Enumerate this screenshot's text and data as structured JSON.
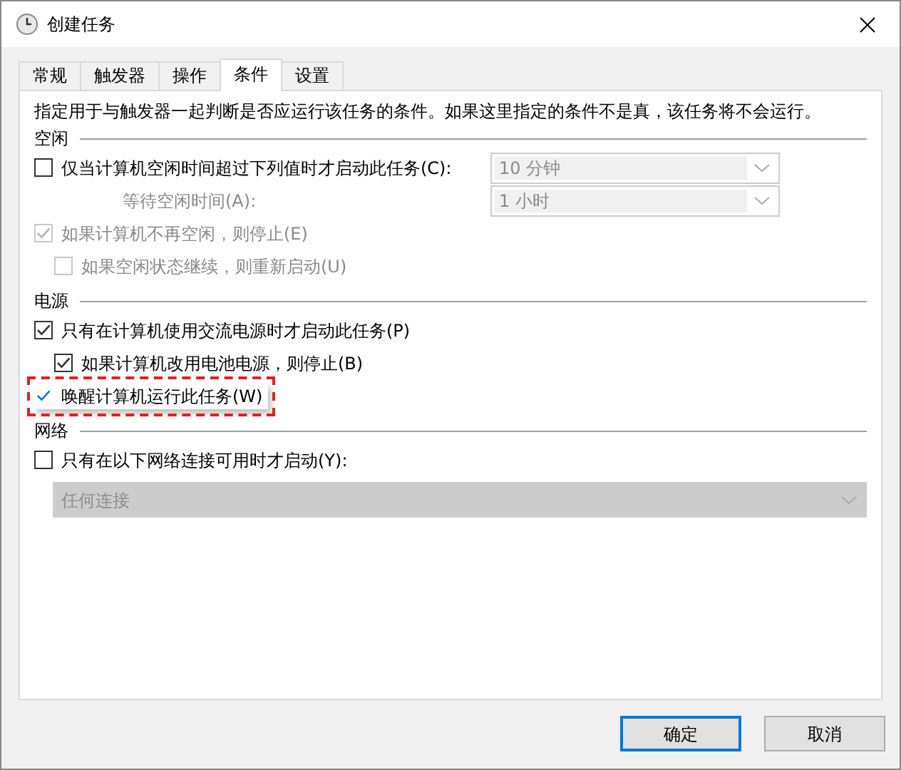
{
  "window": {
    "title": "创建任务"
  },
  "tabs": [
    {
      "label": "常规",
      "selected": false
    },
    {
      "label": "触发器",
      "selected": false
    },
    {
      "label": "操作",
      "selected": false
    },
    {
      "label": "条件",
      "selected": true
    },
    {
      "label": "设置",
      "selected": false
    }
  ],
  "description": "指定用于与触发器一起判断是否应运行该任务的条件。如果这里指定的条件不是真，该任务将不会运行。",
  "sections": [
    {
      "title": "空闲",
      "items": [
        {
          "kind": "checkbox",
          "label": "仅当计算机空闲时间超过下列值时才启动此任务(C):",
          "checked": false,
          "disabled": false,
          "highlighted": false,
          "dropdown": {
            "value": "10 分钟",
            "disabled": true
          }
        },
        {
          "kind": "field",
          "label": "等待空闲时间(A):",
          "disabled": true,
          "dropdown": {
            "value": "1 小时",
            "disabled": true
          }
        },
        {
          "kind": "checkbox",
          "label": "如果计算机不再空闲，则停止(E)",
          "checked": true,
          "disabled": true,
          "highlighted": false,
          "children": [
            {
              "kind": "checkbox",
              "label": "如果空闲状态继续，则重新启动(U)",
              "checked": false,
              "disabled": true,
              "highlighted": false
            }
          ]
        }
      ]
    },
    {
      "title": "电源",
      "items": [
        {
          "kind": "checkbox",
          "label": "只有在计算机使用交流电源时才启动此任务(P)",
          "checked": true,
          "disabled": false,
          "highlighted": false,
          "children": [
            {
              "kind": "checkbox",
              "label": "如果计算机改用电池电源，则停止(B)",
              "checked": true,
              "disabled": false,
              "highlighted": false
            }
          ]
        },
        {
          "kind": "checkbox",
          "label": "唤醒计算机运行此任务(W)",
          "checked": true,
          "disabled": false,
          "highlighted": true
        }
      ]
    },
    {
      "title": "网络",
      "items": [
        {
          "kind": "checkbox",
          "label": "只有在以下网络连接可用时才启动(Y):",
          "checked": false,
          "disabled": false,
          "highlighted": false
        },
        {
          "kind": "dropdown",
          "dropdown": {
            "value": "任何连接",
            "disabled": true
          }
        }
      ]
    }
  ],
  "buttons": [
    {
      "label": "确定",
      "default": true
    },
    {
      "label": "取消",
      "default": false
    }
  ]
}
